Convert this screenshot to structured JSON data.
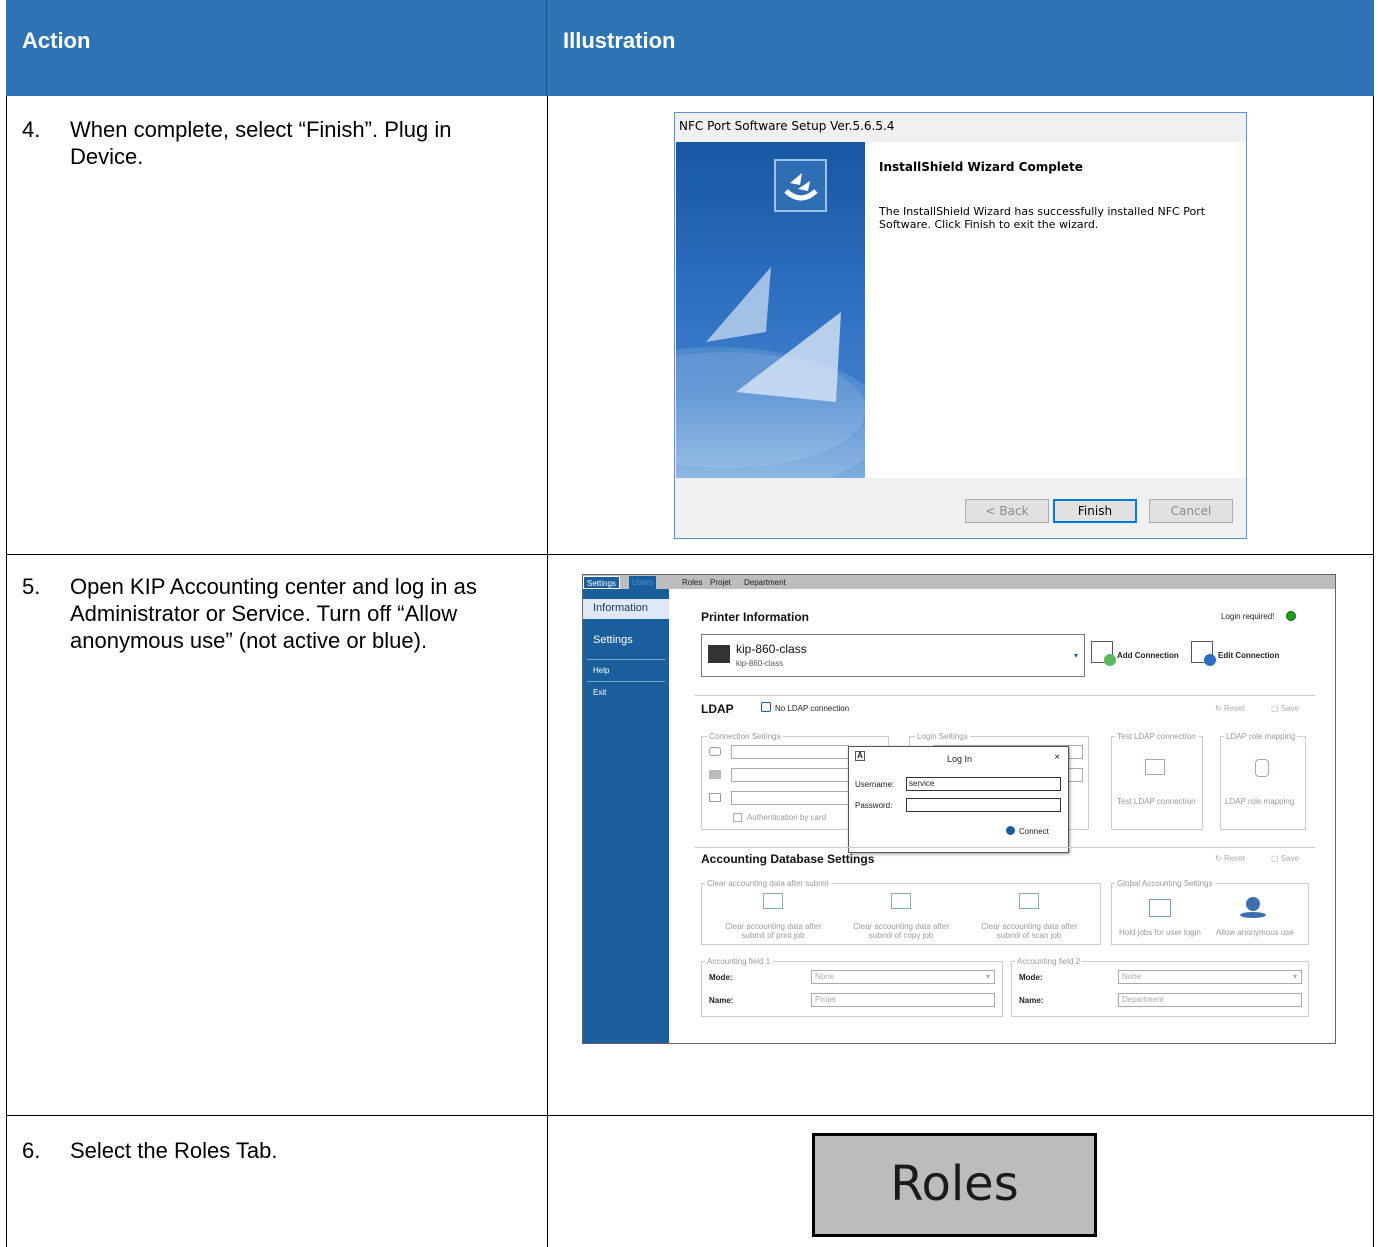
{
  "header": {
    "action": "Action",
    "illustration": "Illustration"
  },
  "rows": [
    {
      "num": "4.",
      "text": "When complete, select “Finish”. Plug in Device."
    },
    {
      "num": "5.",
      "text": "Open KIP Accounting center and log in as Administrator or Service. Turn off “Allow anonymous use” (not active or blue)."
    },
    {
      "num": "6.",
      "text": "Select the Roles Tab."
    }
  ],
  "install": {
    "title": "NFC Port Software Setup  Ver.5.6.5.4",
    "heading": "InstallShield Wizard Complete",
    "body": "The InstallShield Wizard has successfully installed NFC Port Software.  Click Finish to exit the wizard.",
    "back": "< Back",
    "finish": "Finish",
    "cancel": "Cancel"
  },
  "kip": {
    "tabs": [
      "Settings",
      "Users",
      "Roles",
      "Projet",
      "Department"
    ],
    "nav": [
      "Information",
      "Settings",
      "Help",
      "Exit"
    ],
    "printer_title": "Printer Information",
    "login_required": "Login required!",
    "status_color": "#1ea01e",
    "printer_name": "kip-860-class",
    "printer_sub": "kip-860-class",
    "add_connection": "Add Connection",
    "edit_connection": "Edit Connection",
    "ldap_title": "LDAP",
    "no_ldap": "No LDAP connection",
    "reset": "Reset",
    "save": "Save",
    "connection_settings": "Connection Settings",
    "login_settings": "Login Settings",
    "test_ldap": "Test LDAP connection",
    "ldap_role_mapping": "LDAP role mapping",
    "auth_by_card": "Authentication by card",
    "dialog": {
      "title": "Log In",
      "username_label": "Username:",
      "username": "service",
      "password_label": "Password:",
      "connect": "Connect"
    },
    "acct_title": "Accounting Database Settings",
    "clear_group": "Clear accounting data after submit",
    "clear_print": "Clear accounting data after submit of print job",
    "clear_copy": "Clear accounting data after submit of copy job",
    "clear_scan": "Clear accounting data after submit of scan job",
    "global_group": "Global Accounting Settings",
    "hold_jobs": "Hold jobs for user login",
    "allow_anon": "Allow anonymous use",
    "field1": {
      "group": "Accounting field 1",
      "mode_label": "Mode:",
      "mode": "None",
      "name_label": "Name:",
      "name": "Projet"
    },
    "field2": {
      "group": "Accounting field 2",
      "mode_label": "Mode:",
      "mode": "None",
      "name_label": "Name:",
      "name": "Department"
    }
  },
  "roles_tab": "Roles"
}
